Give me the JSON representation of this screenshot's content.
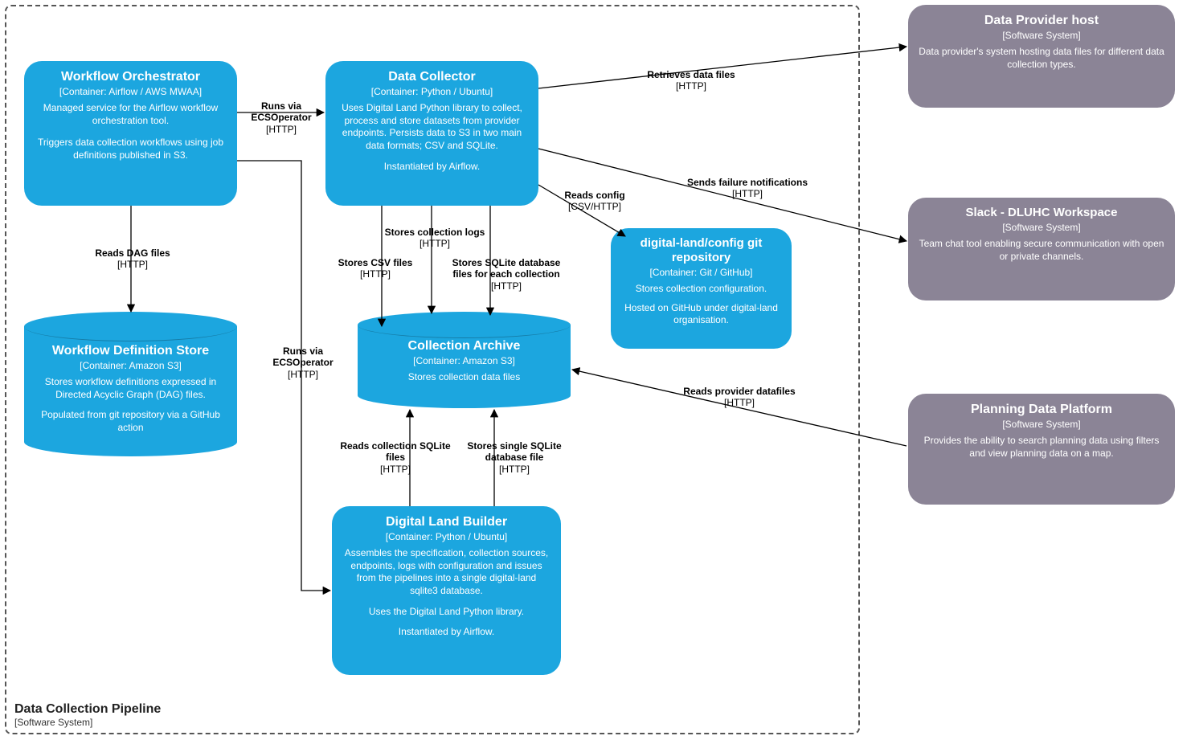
{
  "boundary": {
    "title": "Data Collection Pipeline",
    "subtitle": "[Software System]"
  },
  "nodes": {
    "orchestrator": {
      "title": "Workflow Orchestrator",
      "subtitle": "[Container: Airflow / AWS MWAA]",
      "desc1": "Managed service for the Airflow workflow orchestration tool.",
      "desc2": "Triggers data collection workflows using job definitions published in S3."
    },
    "collector": {
      "title": "Data Collector",
      "subtitle": "[Container: Python / Ubuntu]",
      "desc1": "Uses Digital Land Python library to collect, process and store datasets from provider endpoints. Persists data to S3 in two main data formats; CSV and SQLite.",
      "desc2": "Instantiated by Airflow."
    },
    "configRepo": {
      "title": "digital-land/config git repository",
      "subtitle": "[Container: Git / GitHub]",
      "desc1": "Stores collection configuration.",
      "desc2": "Hosted on GitHub under digital-land organisation."
    },
    "wfStore": {
      "title": "Workflow Definition Store",
      "subtitle": "[Container: Amazon S3]",
      "desc1": "Stores workflow definitions expressed in Directed Acyclic Graph (DAG) files.",
      "desc2": "Populated from git repository via a GitHub action"
    },
    "archive": {
      "title": "Collection Archive",
      "subtitle": "[Container: Amazon S3]",
      "desc1": "Stores collection data files"
    },
    "builder": {
      "title": "Digital Land Builder",
      "subtitle": "[Container: Python / Ubuntu]",
      "desc1": "Assembles the specification, collection sources, endpoints, logs with configuration and issues from the pipelines into a single digital-land sqlite3 database.",
      "desc2": "Uses the Digital Land Python library.",
      "desc3": "Instantiated by Airflow."
    },
    "provider": {
      "title": "Data Provider host",
      "subtitle": "[Software System]",
      "desc1": "Data provider's system hosting data files for different data collection types."
    },
    "slack": {
      "title": "Slack - DLUHC Workspace",
      "subtitle": "[Software System]",
      "desc1": "Team chat tool enabling secure communication with open or private channels."
    },
    "platform": {
      "title": "Planning Data Platform",
      "subtitle": "[Software System]",
      "desc1": "Provides the ability to search planning data using filters and view planning data on a map."
    }
  },
  "edges": {
    "runsCollector": {
      "main": "Runs via ECSOperator",
      "sub": "[HTTP]"
    },
    "readsDag": {
      "main": "Reads DAG files",
      "sub": "[HTTP]"
    },
    "runsBuilder": {
      "main": "Runs via ECSOperator",
      "sub": "[HTTP]"
    },
    "retrieves": {
      "main": "Retrieves data files",
      "sub": "[HTTP]"
    },
    "failure": {
      "main": "Sends failure notifications",
      "sub": "[HTTP]"
    },
    "readsConfig": {
      "main": "Reads config",
      "sub": "[CSV/HTTP]"
    },
    "storesLogs": {
      "main": "Stores collection logs",
      "sub": "[HTTP]"
    },
    "storesCsv": {
      "main": "Stores CSV files",
      "sub": "[HTTP]"
    },
    "storesSqlite": {
      "main": "Stores SQLite database files for each collection",
      "sub": "[HTTP]"
    },
    "readsCollection": {
      "main": "Reads collection SQLite files",
      "sub": "[HTTP]"
    },
    "storesSingle": {
      "main": "Stores single SQLite database file",
      "sub": "[HTTP]"
    },
    "readsProvider": {
      "main": "Reads provider datafiles",
      "sub": "[HTTP]"
    }
  }
}
